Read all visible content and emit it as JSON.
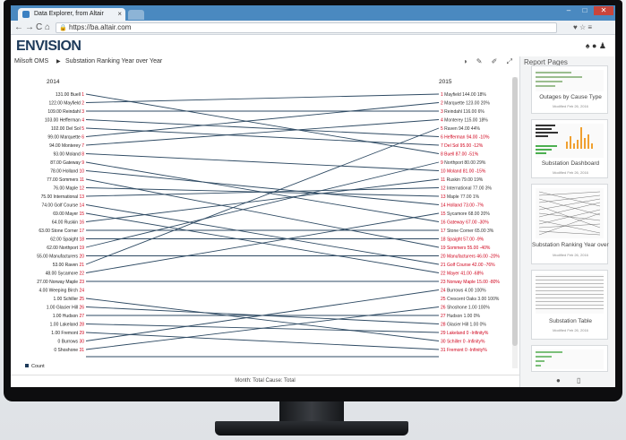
{
  "browser": {
    "tab_title": "Data Explorer, from Altair",
    "tab_close": "×",
    "url": "https://ba.altair.com",
    "back": "←",
    "forward": "→",
    "reload": "C",
    "home": "⌂",
    "lock": "🔒",
    "toolbar_icons": "♥ ☆ ≡",
    "window_controls": [
      "–",
      "□",
      "✕"
    ]
  },
  "app": {
    "logo": "ENVISION",
    "header_icons": "♠ ● ♟"
  },
  "breadcrumb": {
    "parent": "Milsoft OMS",
    "separator": "▶",
    "current": "Substation Ranking Year over Year"
  },
  "toolbar": {
    "icons": "◑ ✎ ✐ ⤢"
  },
  "chart_data": {
    "type": "slope",
    "left_header": "2014",
    "right_header": "2015",
    "legend": "Count",
    "left": [
      {
        "name": "Buell",
        "rank": 1,
        "value": "131.00"
      },
      {
        "name": "Mayfield",
        "rank": 2,
        "value": "122.00"
      },
      {
        "name": "Reindahl",
        "rank": 3,
        "value": "109.00"
      },
      {
        "name": "Hefferman",
        "rank": 4,
        "value": "103.00"
      },
      {
        "name": "Del Sol",
        "rank": 5,
        "value": "102.00"
      },
      {
        "name": "Marquette",
        "rank": 6,
        "value": "99.00"
      },
      {
        "name": "Monterey",
        "rank": 7,
        "value": "94.00"
      },
      {
        "name": "Moland",
        "rank": 8,
        "value": "93.00"
      },
      {
        "name": "Gateway",
        "rank": 9,
        "value": "87.00"
      },
      {
        "name": "Holland",
        "rank": 10,
        "value": "78.00"
      },
      {
        "name": "Sommers",
        "rank": 11,
        "value": "77.00"
      },
      {
        "name": "Maple",
        "rank": 12,
        "value": "76.00"
      },
      {
        "name": "International",
        "rank": 13,
        "value": "75.00"
      },
      {
        "name": "Golf Course",
        "rank": 14,
        "value": "74.00"
      },
      {
        "name": "Mayer",
        "rank": 15,
        "value": "69.00"
      },
      {
        "name": "Ruskin",
        "rank": 16,
        "value": "64.00"
      },
      {
        "name": "Stone Corner",
        "rank": 17,
        "value": "63.00"
      },
      {
        "name": "Spaight",
        "rank": 18,
        "value": "62.00"
      },
      {
        "name": "Northport",
        "rank": 19,
        "value": "62.00"
      },
      {
        "name": "Manufacturers",
        "rank": 20,
        "value": "55.00"
      },
      {
        "name": "Raven",
        "rank": 21,
        "value": "53.00"
      },
      {
        "name": "Sycamore",
        "rank": 22,
        "value": "48.00"
      },
      {
        "name": "Norway Maple",
        "rank": 23,
        "value": "27.00"
      },
      {
        "name": "Weeping Birch",
        "rank": 24,
        "value": "4.00"
      },
      {
        "name": "Schiller",
        "rank": 25,
        "value": "1.00"
      },
      {
        "name": "Glacier Hill",
        "rank": 26,
        "value": "1.00"
      },
      {
        "name": "Hudson",
        "rank": 27,
        "value": "1.00"
      },
      {
        "name": "Lakeland",
        "rank": 28,
        "value": "1.00"
      },
      {
        "name": "Fremont",
        "rank": 29,
        "value": "1.00"
      },
      {
        "name": "Burrows",
        "rank": 30,
        "value": "0"
      },
      {
        "name": "Shoshone",
        "rank": 31,
        "value": "0"
      }
    ],
    "right": [
      {
        "name": "Mayfield",
        "rank": 1,
        "value": "144.00",
        "change": "18%",
        "up": true
      },
      {
        "name": "Marquette",
        "rank": 2,
        "value": "123.00",
        "change": "20%",
        "up": true
      },
      {
        "name": "Reindahl",
        "rank": 3,
        "value": "116.00",
        "change": "6%",
        "up": true
      },
      {
        "name": "Monterey",
        "rank": 4,
        "value": "115.00",
        "change": "18%",
        "up": true
      },
      {
        "name": "Raven",
        "rank": 5,
        "value": "94.00",
        "change": "44%",
        "up": true
      },
      {
        "name": "Hefferman",
        "rank": 6,
        "value": "94.00",
        "change": "-10%",
        "up": false
      },
      {
        "name": "Del Sol",
        "rank": 7,
        "value": "95.00",
        "change": "-12%",
        "up": false
      },
      {
        "name": "Buell",
        "rank": 8,
        "value": "87.00",
        "change": "-51%",
        "up": false
      },
      {
        "name": "Northport",
        "rank": 9,
        "value": "80.00",
        "change": "29%",
        "up": true
      },
      {
        "name": "Moland",
        "rank": 10,
        "value": "81.00",
        "change": "-15%",
        "up": false
      },
      {
        "name": "Ruskin",
        "rank": 11,
        "value": "79.00",
        "change": "19%",
        "up": true
      },
      {
        "name": "International",
        "rank": 12,
        "value": "77.00",
        "change": "3%",
        "up": true
      },
      {
        "name": "Maple",
        "rank": 13,
        "value": "77.00",
        "change": "1%",
        "up": true
      },
      {
        "name": "Holland",
        "rank": 14,
        "value": "73.00",
        "change": "-7%",
        "up": false
      },
      {
        "name": "Sycamore",
        "rank": 15,
        "value": "68.00",
        "change": "20%",
        "up": true
      },
      {
        "name": "Gateway",
        "rank": 16,
        "value": "67.00",
        "change": "-30%",
        "up": false
      },
      {
        "name": "Stone Corner",
        "rank": 17,
        "value": "65.00",
        "change": "3%",
        "up": true
      },
      {
        "name": "Spaight",
        "rank": 18,
        "value": "57.00",
        "change": "-9%",
        "up": false
      },
      {
        "name": "Sommers",
        "rank": 19,
        "value": "55.00",
        "change": "-40%",
        "up": false
      },
      {
        "name": "Manufacturers",
        "rank": 20,
        "value": "46.00",
        "change": "-20%",
        "up": false
      },
      {
        "name": "Golf Course",
        "rank": 21,
        "value": "42.00",
        "change": "-76%",
        "up": false
      },
      {
        "name": "Mayer",
        "rank": 22,
        "value": "41.00",
        "change": "-68%",
        "up": false
      },
      {
        "name": "Norway Maple",
        "rank": 23,
        "value": "15.00",
        "change": "-80%",
        "up": false
      },
      {
        "name": "Burrows",
        "rank": 24,
        "value": "4.00",
        "change": "100%",
        "up": true
      },
      {
        "name": "Crescent Oaks",
        "rank": 25,
        "value": "3.00",
        "change": "100%",
        "up": true
      },
      {
        "name": "Shoshone",
        "rank": 26,
        "value": "1.00",
        "change": "100%",
        "up": true
      },
      {
        "name": "Hudson",
        "rank": 27,
        "value": "1.00",
        "change": "0%",
        "up": true
      },
      {
        "name": "Glacier Hill",
        "rank": 28,
        "value": "1.00",
        "change": "0%",
        "up": true
      },
      {
        "name": "Lakeland",
        "rank": 29,
        "value": "0",
        "change": "-Infinity%",
        "up": false
      },
      {
        "name": "Schiller",
        "rank": 30,
        "value": "0",
        "change": "-Infinity%",
        "up": false
      },
      {
        "name": "Fremont",
        "rank": 31,
        "value": "0",
        "change": "-Infinity%",
        "up": false
      }
    ],
    "colors": {
      "line": "#2e4a63",
      "up": "#333333",
      "down": "#d0021b",
      "rank": "#d0021b"
    }
  },
  "status": {
    "text": "Month: Total   Cause: Total"
  },
  "report_pages": {
    "title": "Report Pages",
    "items": [
      {
        "label": "Outages by Cause Type",
        "sub": "Modified Feb 26, 2016"
      },
      {
        "label": "Substation Dashboard",
        "sub": "Modified Feb 26, 2016"
      },
      {
        "label": "Substation Ranking Year over Y...",
        "sub": "Modified Feb 26, 2016"
      },
      {
        "label": "Substation Table",
        "sub": "Modified Feb 26, 2016"
      }
    ],
    "footer_icons": "● ▯"
  }
}
